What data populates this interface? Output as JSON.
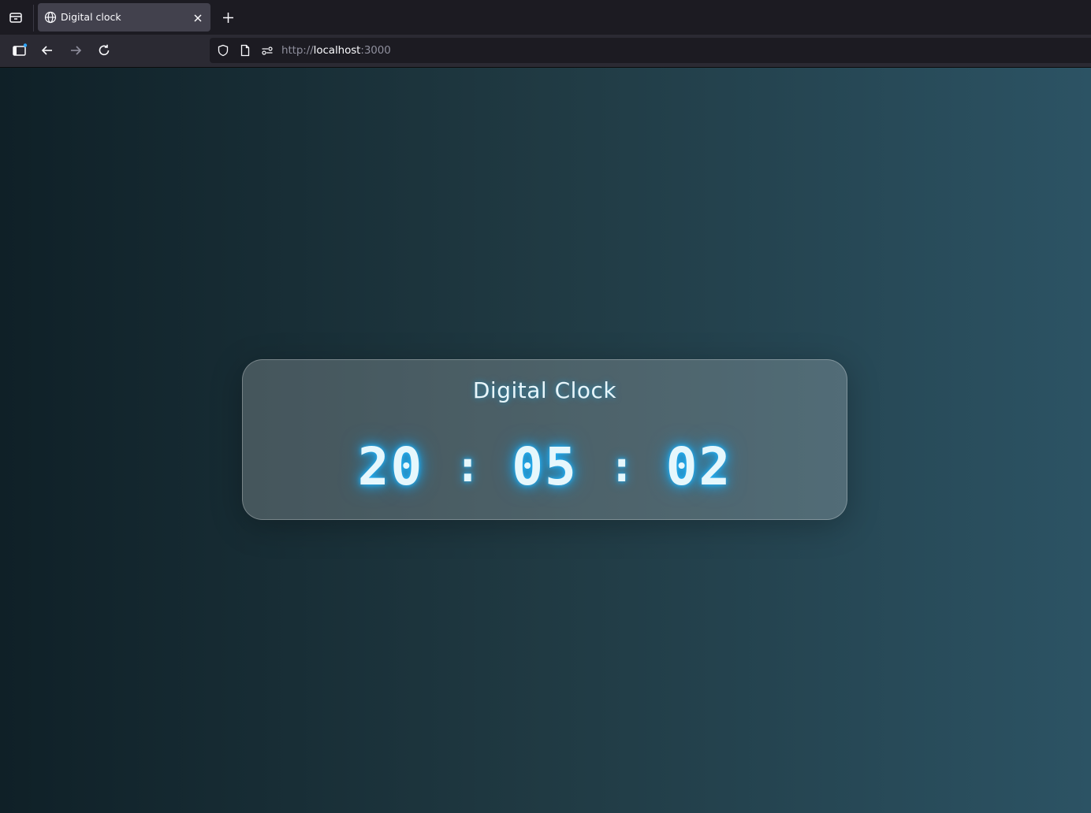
{
  "browser": {
    "tab": {
      "title": "Digital clock"
    },
    "url": {
      "scheme": "http://",
      "host": "localhost",
      "port": ":3000"
    }
  },
  "clock": {
    "title": "Digital Clock",
    "hours": "20",
    "minutes": "05",
    "seconds": "02",
    "separator": ":"
  },
  "colors": {
    "accent_glow": "#1fb6ff",
    "gradient_left": "#0f2027",
    "gradient_mid": "#203a43",
    "gradient_right": "#2c5364"
  }
}
